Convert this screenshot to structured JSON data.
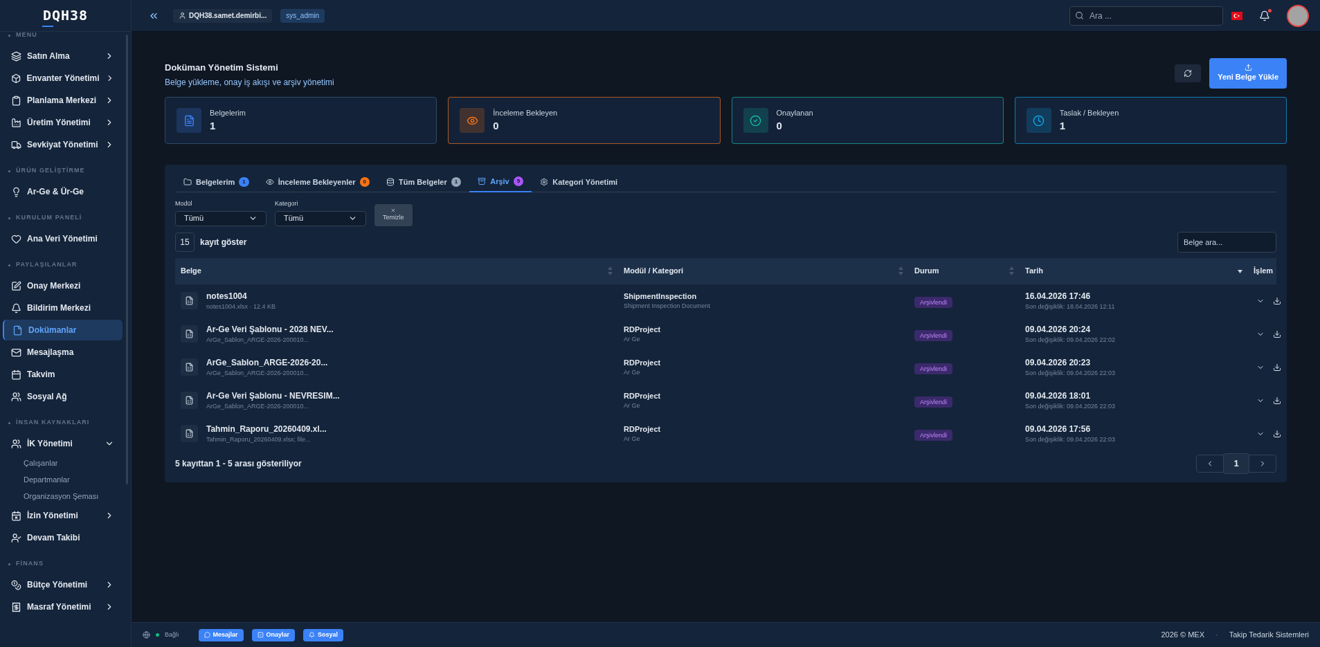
{
  "sidebar": {
    "logo": "DQH38",
    "sections": [
      {
        "label": "MENU",
        "items": [
          {
            "label": "Satın Alma",
            "selected": false,
            "expanded": false
          },
          {
            "label": "Envanter Yönetimi",
            "selected": false,
            "expanded": false
          },
          {
            "label": "Planlama Merkezi",
            "selected": false,
            "expanded": false
          },
          {
            "label": "Üretim Yönetimi",
            "selected": false,
            "expanded": false
          },
          {
            "label": "Sevkiyat Yönetimi",
            "selected": false,
            "expanded": false
          }
        ]
      },
      {
        "label": "ÜRÜN GELİŞTİRME",
        "items": [
          {
            "label": "Ar-Ge & Ür-Ge",
            "selected": false
          }
        ]
      },
      {
        "label": "KURULUM PANELİ",
        "items": [
          {
            "label": "Ana Veri Yönetimi",
            "selected": false
          }
        ]
      },
      {
        "label": "PAYLAŞILANLAR",
        "items": [
          {
            "label": "Onay Merkezi",
            "selected": false
          },
          {
            "label": "Bildirim Merkezi",
            "selected": false
          },
          {
            "label": "Dokümanlar",
            "selected": true
          },
          {
            "label": "Mesajlaşma",
            "selected": false
          },
          {
            "label": "Takvim",
            "selected": false
          },
          {
            "label": "Sosyal Ağ",
            "selected": false
          }
        ]
      },
      {
        "label": "İNSAN KAYNAKLARI",
        "items": [
          {
            "label": "İK Yönetimi",
            "selected": false,
            "expanded": true,
            "children": [
              {
                "label": "Çalışanlar"
              },
              {
                "label": "Departmanlar"
              },
              {
                "label": "Organizasyon Şeması"
              }
            ]
          },
          {
            "label": "İzin Yönetimi",
            "selected": false,
            "expanded": false
          },
          {
            "label": "Devam Takibi",
            "selected": false
          }
        ]
      },
      {
        "label": "FİNANS",
        "items": [
          {
            "label": "Bütçe Yönetimi",
            "selected": false,
            "expanded": false
          },
          {
            "label": "Masraf Yönetimi",
            "selected": false,
            "expanded": false
          }
        ]
      }
    ]
  },
  "topbar": {
    "user": "DQH38.samet.demirbi...",
    "role": "sys_admin",
    "search": {
      "placeholder": "Ara ..."
    },
    "notification": true
  },
  "header": {
    "title": "Doküman Yönetim Sistemi",
    "subtitle": "Belge yükleme, onay iş akışı ve arşiv yönetimi",
    "upload_button": "Yeni Belge Yükle"
  },
  "stats": [
    {
      "label": "Belgelerim",
      "value": "1",
      "color": "#3b82f6"
    },
    {
      "label": "İnceleme Bekleyen",
      "value": "0",
      "color": "#f97316"
    },
    {
      "label": "Onaylanan",
      "value": "0",
      "color": "#14b8a6"
    },
    {
      "label": "Taslak / Bekleyen",
      "value": "1",
      "color": "#0ea5e9"
    }
  ],
  "tabs": [
    {
      "label": "Belgelerim",
      "count": "1",
      "color": "#3b82f6",
      "selected": false
    },
    {
      "label": "İnceleme Bekleyenler",
      "count": "0",
      "color": "#f97316",
      "selected": false
    },
    {
      "label": "Tüm Belgeler",
      "count": "1",
      "color": "#94a3b8",
      "selected": false
    },
    {
      "label": "Arşiv",
      "count": "5",
      "color": "#a855f7",
      "selected": true
    },
    {
      "label": "Kategori Yönetimi",
      "selected": false
    }
  ],
  "filters": [
    {
      "label": "Modül",
      "value": "Tümü"
    },
    {
      "label": "Kategori",
      "value": "Tümü"
    }
  ],
  "clear_button": "Temizle",
  "page_size": {
    "value": "15",
    "label": "kayıt göster"
  },
  "table_search": {
    "placeholder": "Belge ara..."
  },
  "table": {
    "columns": [
      {
        "label": "Belge",
        "sorted": false
      },
      {
        "label": "Modül / Kategori",
        "sorted": false
      },
      {
        "label": "Durum",
        "sorted": false
      },
      {
        "label": "Tarih",
        "sorted": true
      },
      {
        "label": "İşlem"
      }
    ],
    "rows": [
      {
        "name": "notes1004",
        "file": "notes1004.xlsx · 12.4 KB",
        "module": "ShipmentInspection",
        "category": "Shipment Inspection Document",
        "status": "Arşivlendi",
        "date": "16.04.2026 17:46",
        "modified": "Son değişiklik: 18.04.2026 12:11"
      },
      {
        "name": "Ar-Ge Veri Şablonu - 2028 NEV...",
        "file": "ArGe_Sablon_ARGE-2026-200010...",
        "module": "RDProject",
        "category": "Ar Ge",
        "status": "Arşivlendi",
        "date": "09.04.2026 20:24",
        "modified": "Son değişiklik: 09.04.2026 22:02"
      },
      {
        "name": "ArGe_Sablon_ARGE-2026-20...",
        "file": "ArGe_Sablon_ARGE-2026-200010...",
        "module": "RDProject",
        "category": "Ar Ge",
        "status": "Arşivlendi",
        "date": "09.04.2026 20:23",
        "modified": "Son değişiklik: 09.04.2026 22:03"
      },
      {
        "name": "Ar-Ge Veri Şablonu - NEVRESIM...",
        "file": "ArGe_Sablon_ARGE-2026-200010...",
        "module": "RDProject",
        "category": "Ar Ge",
        "status": "Arşivlendi",
        "date": "09.04.2026 18:01",
        "modified": "Son değişiklik: 09.04.2026 22:03"
      },
      {
        "name": "Tahmin_Raporu_20260409.xl...",
        "file": "Tahmin_Raporu_20260409.xlsx; file...",
        "module": "RDProject",
        "category": "Ar Ge",
        "status": "Arşivlendi",
        "date": "09.04.2026 17:56",
        "modified": "Son değişiklik: 09.04.2026 22:03"
      }
    ]
  },
  "footer_text": "5 kayıttan 1 - 5 arası gösteriliyor",
  "pagination": {
    "pages": [
      {
        "label": "1",
        "selected": true
      }
    ]
  },
  "statusbar": {
    "connection": "Bağlı",
    "connected": true,
    "buttons": [
      "Mesajlar",
      "Onaylar",
      "Sosyal"
    ],
    "copyright": "2026 © MEX",
    "separator": "·",
    "company": "Takip Tedarik Sistemleri"
  }
}
